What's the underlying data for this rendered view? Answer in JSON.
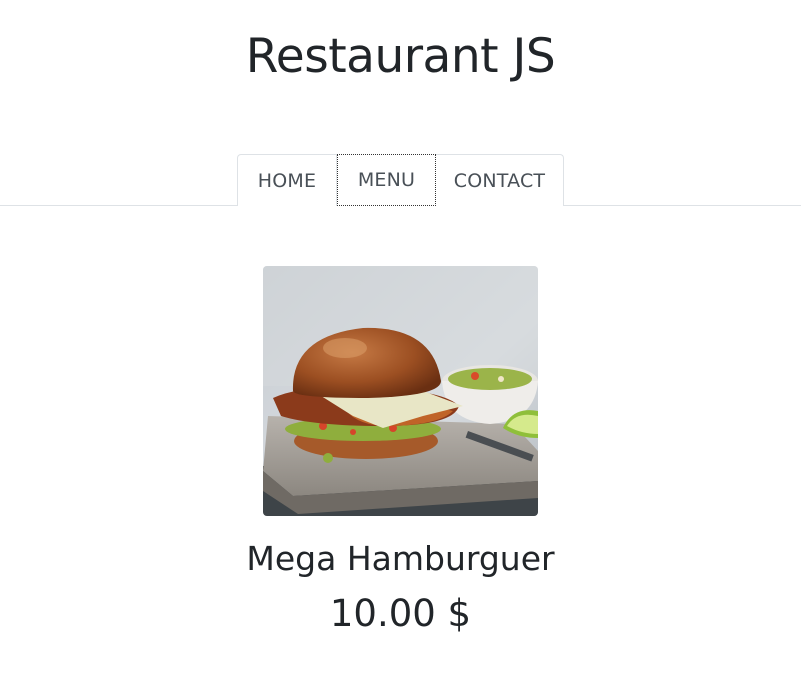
{
  "header": {
    "title": "Restaurant JS"
  },
  "nav": {
    "tabs": [
      {
        "label": "HOME"
      },
      {
        "label": "MENU"
      },
      {
        "label": "CONTACT"
      }
    ],
    "focused_tab": "MENU"
  },
  "menu_item": {
    "image_subject": "hamburger-photo",
    "name": "Mega Hamburguer",
    "price": "10.00 $"
  },
  "colors": {
    "text": "#212529",
    "tab_text": "#495057",
    "border": "#dee2e6"
  }
}
